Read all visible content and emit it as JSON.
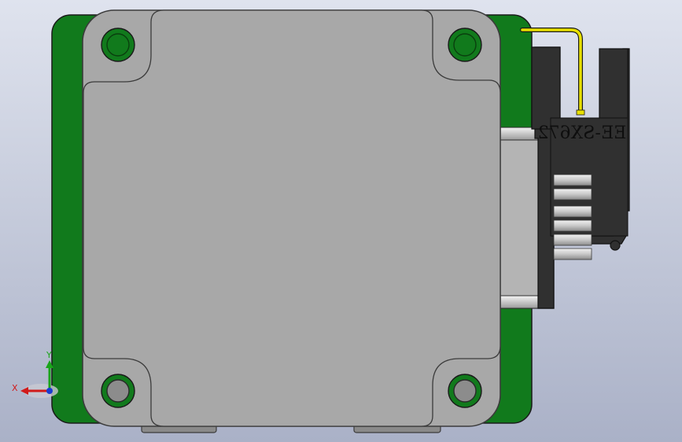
{
  "viewport": {
    "background_top": "#dfe3ee",
    "background_bottom": "#aab1c7"
  },
  "model": {
    "sensor_label": "EE-SX672",
    "colors": {
      "pcb_green": "#117a1c",
      "motor_gray": "#a8a8a8",
      "motor_outline": "#3b3b3b",
      "sensor_dark": "#303030",
      "wire_yellow": "#e8e000",
      "connector_gray": "#b4b4b4",
      "pin_light": "#e6e6e6"
    }
  },
  "triad": {
    "x_label": "X",
    "y_label": "Y",
    "x_color": "#d11a1a",
    "y_color": "#1aa51a",
    "z_color": "#1a3cd1"
  }
}
